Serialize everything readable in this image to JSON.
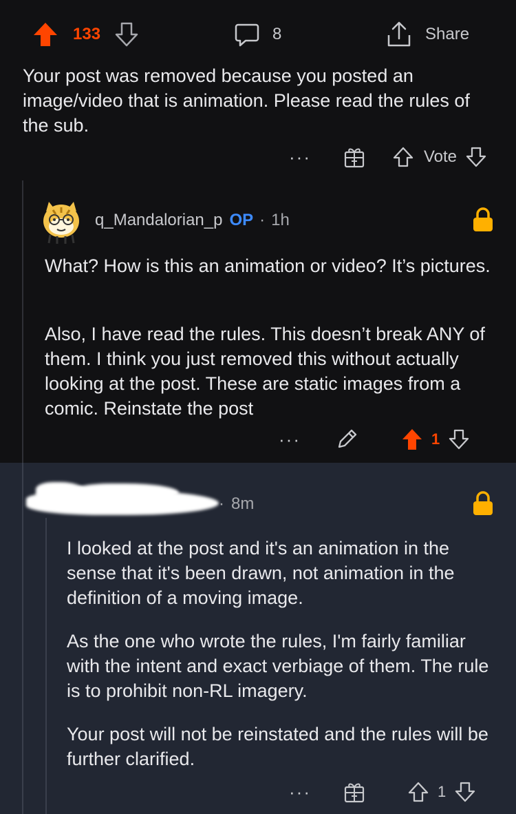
{
  "post_bar": {
    "upvotes": "133",
    "comments": "8",
    "share_label": "Share"
  },
  "automod_comment": {
    "text": "Your post was removed because you posted an image/video that is animation. Please read the rules of the sub.",
    "more": "···",
    "vote_label": "Vote"
  },
  "op_comment": {
    "username": "q_Mandalorian_p",
    "op_badge": "OP",
    "separator": "·",
    "time": "1h",
    "paragraphs": [
      "What? How is this an animation or video? It’s pictures.",
      "Also, I have read the rules. This doesn’t break ANY of them. I think you just removed this without actually looking at the post. These are static images from a comic. Reinstate the post"
    ],
    "more": "···",
    "score": "1"
  },
  "mod_comment": {
    "separator": "·",
    "time": "8m",
    "paragraphs": [
      "I looked at the post and it's an animation in the sense that it's been drawn, not animation in the definition of a moving image.",
      "As the one who wrote the rules, I'm fairly familiar with the intent and exact verbiage of them. The rule is to prohibit non-RL imagery.",
      "Your post will not be reinstated and the rules will be further clarified."
    ],
    "more": "···",
    "score": "1"
  },
  "colors": {
    "background": "#111113",
    "highlight": "#222733",
    "upvote_active": "#ff4500",
    "op_badge": "#3d8bff",
    "lock": "#ffb000"
  },
  "icons": [
    "upvote-icon",
    "downvote-icon",
    "comment-icon",
    "share-icon",
    "award-icon",
    "lock-icon",
    "edit-icon",
    "avatar"
  ]
}
